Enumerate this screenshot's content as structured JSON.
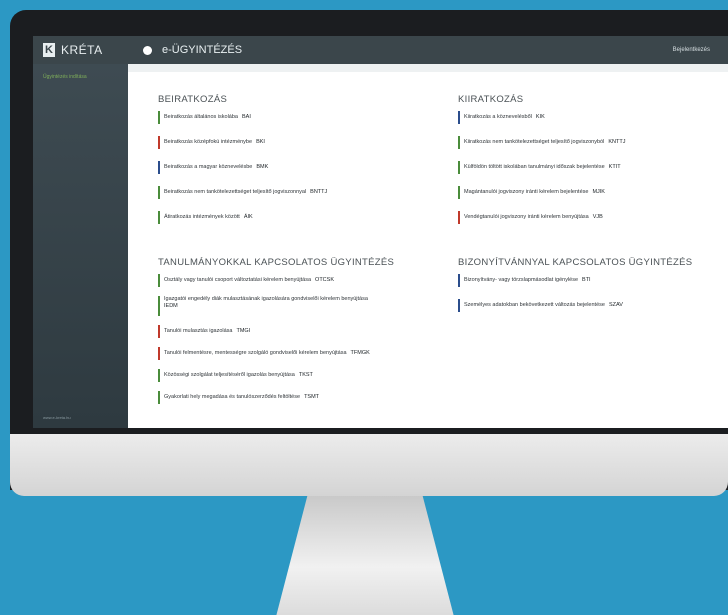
{
  "app": {
    "name": "KRÉTA",
    "logo_letter": "K",
    "module_title": "e-ÜGYINTÉZÉS",
    "user_menu": "Bejelentkezés"
  },
  "sidebar": {
    "item": "Ügyintézés indítása",
    "footer": "www.e-kreta.hu"
  },
  "sections": {
    "beiratkozas": {
      "title": "BEIRATKOZÁS",
      "items": [
        {
          "label": "Beiratkozás általános iskolába",
          "code": "BAI",
          "color": "#4a8c3b"
        },
        {
          "label": "Beiratkozás középfokú intézménybe",
          "code": "BKI",
          "color": "#c0392b"
        },
        {
          "label": "Beiratkozás a magyar köznevelésbe",
          "code": "BMK",
          "color": "#2b4d8c"
        },
        {
          "label": "Beiratkozás nem tankötelezettséget teljesítő jogviszonnyal",
          "code": "BNTTJ",
          "color": "#4a8c3b"
        },
        {
          "label": "Átiratkozás intézmények között",
          "code": "ÁIK",
          "color": "#4a8c3b"
        }
      ]
    },
    "kiiratkozas": {
      "title": "KIIRATKOZÁS",
      "items": [
        {
          "label": "Kiiratkozás a köznevelésből",
          "code": "KIK",
          "color": "#2b4d8c"
        },
        {
          "label": "Kiiratkozás nem tankötelezettséget teljesítő jogviszonyból",
          "code": "KNTTJ",
          "color": "#4a8c3b"
        },
        {
          "label": "Külföldön töltött iskolában tanulmányi időszak bejelentése",
          "code": "KTIT",
          "color": "#4a8c3b"
        },
        {
          "label": "Magántanulói jogviszony iránti kérelem bejelentése",
          "code": "MJIK",
          "color": "#4a8c3b"
        },
        {
          "label": "Vendégtanulói jogviszony iránti kérelem benyújtása",
          "code": "VJB",
          "color": "#c0392b"
        }
      ]
    },
    "tanulmanyok": {
      "title": "TANULMÁNYOKKAL KAPCSOLATOS ÜGYINTÉZÉS",
      "items": [
        {
          "label": "Osztály vagy tanulói csoport változtatási kérelem benyújtása",
          "code": "OTCSK",
          "color": "#4a8c3b"
        },
        {
          "label": "Igazgatói engedély diák mulasztásának igazolására gondviselői kérelem benyújtása",
          "code": "IEDM",
          "color": "#4a8c3b"
        },
        {
          "label": "Tanulói mulasztás igazolása",
          "code": "TMGI",
          "color": "#c0392b"
        },
        {
          "label": "Tanulói felmentésre, mentességre szolgáló gondviselői kérelem benyújtása",
          "code": "TFMGK",
          "color": "#c0392b"
        },
        {
          "label": "Közösségi szolgálat teljesítéséről igazolás benyújtása",
          "code": "TKST",
          "color": "#4a8c3b"
        },
        {
          "label": "Gyakorlati hely megadása és tanulószerződés feltöltése",
          "code": "TSMT",
          "color": "#4a8c3b"
        }
      ]
    },
    "bizonyitvany": {
      "title": "BIZONYÍTVÁNNYAL KAPCSOLATOS ÜGYINTÉZÉS",
      "items": [
        {
          "label": "Bizonyítvány- vagy törzslapmásodlat igénylése",
          "code": "BTI",
          "color": "#2b4d8c"
        },
        {
          "label": "Személyes adatokban bekövetkezett változás bejelentése",
          "code": "SZAV",
          "color": "#2b4d8c"
        }
      ]
    }
  }
}
